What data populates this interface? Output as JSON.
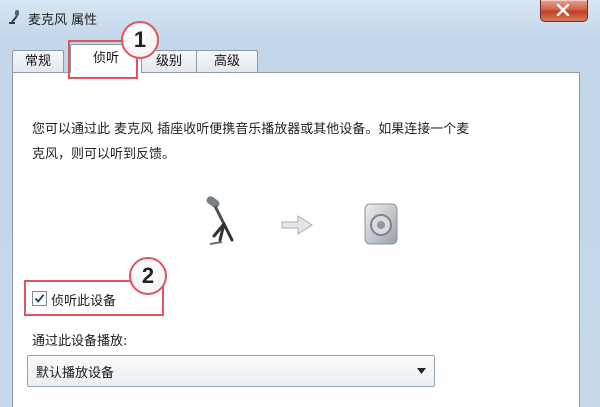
{
  "window": {
    "title": "麦克风 属性",
    "title_icon": "microphone-icon",
    "close_icon": "close-icon"
  },
  "tabs": [
    {
      "label": "常规",
      "active": false
    },
    {
      "label": "侦听",
      "active": true
    },
    {
      "label": "级别",
      "active": false
    },
    {
      "label": "高级",
      "active": false
    }
  ],
  "panel": {
    "description_line1": "您可以通过此 麦克风 插座收听便携音乐播放器或其他设备。如果连接一个麦",
    "description_line2": "克风，则可以听到反馈。",
    "illustration": {
      "source_icon": "microphone-stand-icon",
      "arrow_icon": "arrow-right-icon",
      "target_icon": "speaker-icon"
    },
    "listen_checkbox": {
      "label": "侦听此设备",
      "checked": true
    },
    "playback_label": "通过此设备播放:",
    "playback_select": {
      "value": "默认播放设备"
    }
  },
  "annotations": [
    {
      "number": "1",
      "color": "#e2545d"
    },
    {
      "number": "2",
      "color": "#e2545d"
    }
  ]
}
